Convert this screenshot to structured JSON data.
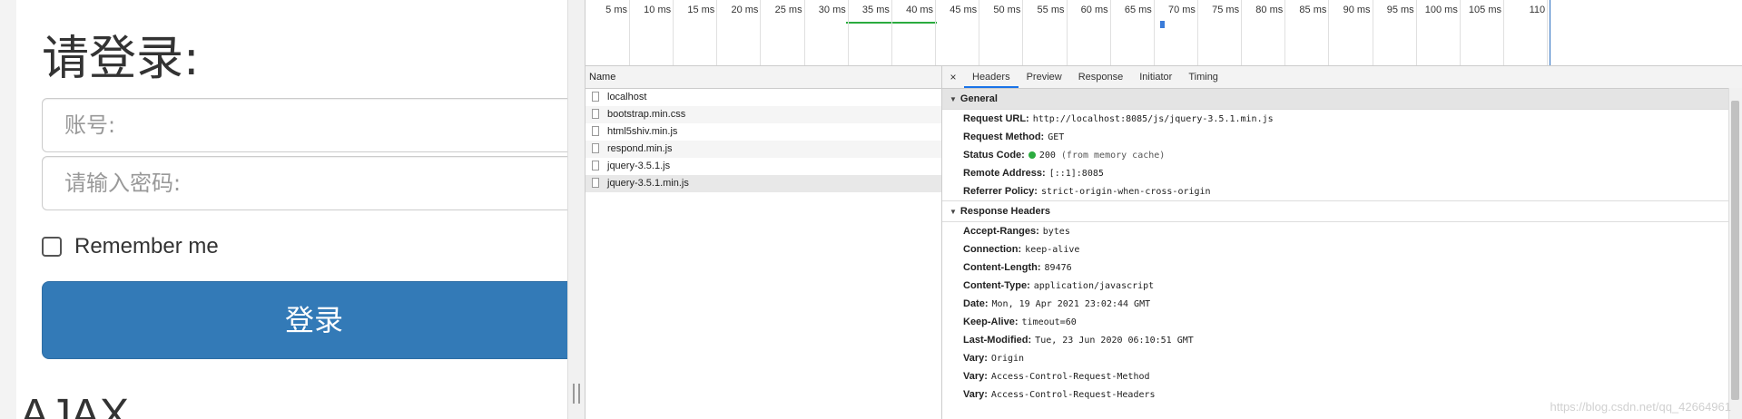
{
  "login": {
    "title": "请登录:",
    "account_placeholder": "账号:",
    "password_placeholder": "请输入密码:",
    "remember_label": "Remember me",
    "submit_label": "登录",
    "next_heading": "AJAX"
  },
  "timeline": {
    "ticks": [
      "5 ms",
      "10 ms",
      "15 ms",
      "20 ms",
      "25 ms",
      "30 ms",
      "35 ms",
      "40 ms",
      "45 ms",
      "50 ms",
      "55 ms",
      "60 ms",
      "65 ms",
      "70 ms",
      "75 ms",
      "80 ms",
      "85 ms",
      "90 ms",
      "95 ms",
      "100 ms",
      "105 ms",
      "110"
    ]
  },
  "network": {
    "name_header": "Name",
    "files": [
      "localhost",
      "bootstrap.min.css",
      "html5shiv.min.js",
      "respond.min.js",
      "jquery-3.5.1.js",
      "jquery-3.5.1.min.js"
    ],
    "selected_index": 5
  },
  "detail": {
    "close": "×",
    "tabs": [
      "Headers",
      "Preview",
      "Response",
      "Initiator",
      "Timing"
    ],
    "active_tab": "Headers",
    "general_title": "General",
    "general": [
      {
        "k": "Request URL:",
        "v": "http://localhost:8085/js/jquery-3.5.1.min.js"
      },
      {
        "k": "Request Method:",
        "v": "GET"
      },
      {
        "k": "Status Code:",
        "v": "200",
        "note": "(from memory cache)",
        "status_color": "#2bab3f"
      },
      {
        "k": "Remote Address:",
        "v": "[::1]:8085"
      },
      {
        "k": "Referrer Policy:",
        "v": "strict-origin-when-cross-origin"
      }
    ],
    "response_title": "Response Headers",
    "response": [
      {
        "k": "Accept-Ranges:",
        "v": "bytes"
      },
      {
        "k": "Connection:",
        "v": "keep-alive"
      },
      {
        "k": "Content-Length:",
        "v": "89476"
      },
      {
        "k": "Content-Type:",
        "v": "application/javascript"
      },
      {
        "k": "Date:",
        "v": "Mon, 19 Apr 2021 23:02:44 GMT"
      },
      {
        "k": "Keep-Alive:",
        "v": "timeout=60"
      },
      {
        "k": "Last-Modified:",
        "v": "Tue, 23 Jun 2020 06:10:51 GMT"
      },
      {
        "k": "Vary:",
        "v": "Origin"
      },
      {
        "k": "Vary:",
        "v": "Access-Control-Request-Method"
      },
      {
        "k": "Vary:",
        "v": "Access-Control-Request-Headers"
      }
    ]
  },
  "watermark": "https://blog.csdn.net/qq_42664961",
  "colors": {
    "primary_button": "#337ab7",
    "status_ok": "#2bab3f",
    "tab_active": "#1a73e8"
  }
}
